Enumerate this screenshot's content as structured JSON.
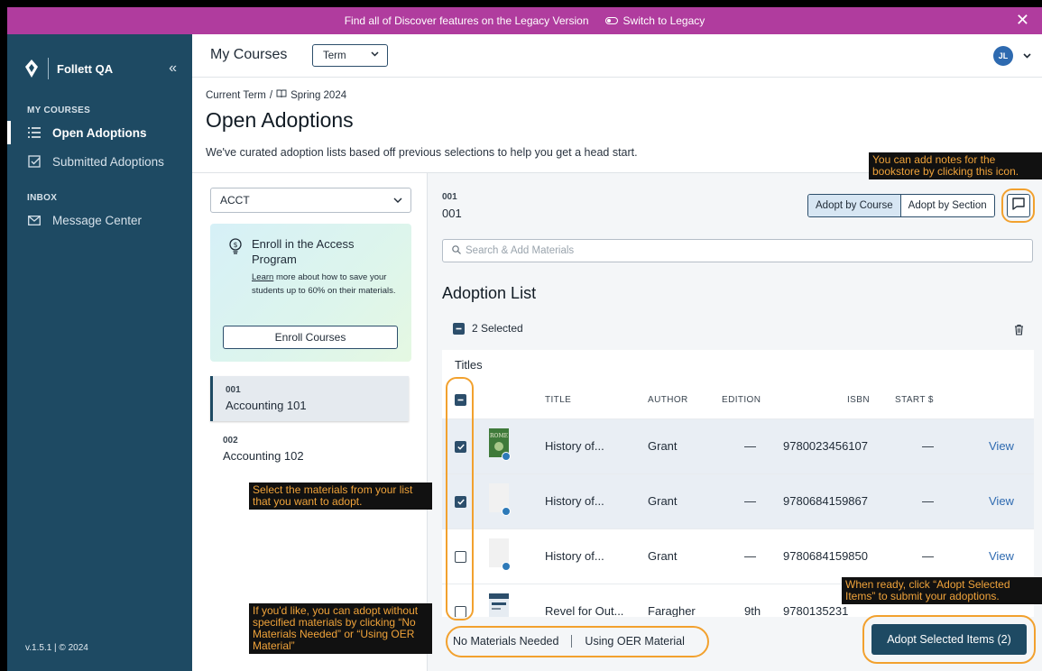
{
  "banner": {
    "text": "Find all of Discover features on the Legacy Version",
    "switch_label": "Switch to Legacy"
  },
  "sidebar": {
    "brand": "Follett QA",
    "section1": "MY COURSES",
    "items": [
      {
        "label": "Open Adoptions"
      },
      {
        "label": "Submitted Adoptions"
      }
    ],
    "section2": "INBOX",
    "inbox_item": "Message Center",
    "version": "v.1.5.1 | © 2024"
  },
  "header": {
    "title": "My Courses",
    "term_select": "Term",
    "avatar_initials": "JL"
  },
  "breadcrumb": {
    "current": "Current Term",
    "sep": "/",
    "term": "Spring 2024"
  },
  "page": {
    "title": "Open Adoptions",
    "subtitle": "We've curated adoption lists based off previous selections to help you get a head start."
  },
  "left": {
    "dept": "ACCT",
    "promo": {
      "title": "Enroll in the Access Program",
      "link": "Learn",
      "desc": " more about how to save your students up to 60% on their materials.",
      "button": "Enroll Courses"
    },
    "courses": [
      {
        "num": "001",
        "name": "Accounting 101"
      },
      {
        "num": "002",
        "name": "Accounting 102"
      }
    ]
  },
  "section": {
    "num": "001",
    "name": "001",
    "toggle": [
      "Adopt by Course",
      "Adopt by Section"
    ]
  },
  "search": {
    "placeholder": "Search & Add Materials"
  },
  "adoption": {
    "title": "Adoption List",
    "selected": "2 Selected",
    "titles_label": "Titles",
    "columns": [
      "TITLE",
      "AUTHOR",
      "EDITION",
      "ISBN",
      "START $"
    ],
    "rows": [
      {
        "title": "History of...",
        "author": "Grant",
        "edition": "—",
        "isbn": "9780023456107",
        "start": "—",
        "action": "View"
      },
      {
        "title": "History of...",
        "author": "Grant",
        "edition": "—",
        "isbn": "9780684159867",
        "start": "—",
        "action": "View"
      },
      {
        "title": "History of...",
        "author": "Grant",
        "edition": "—",
        "isbn": "9780684159850",
        "start": "—",
        "action": "View"
      },
      {
        "title": "Revel for Out...",
        "author": "Faragher",
        "edition": "9th",
        "isbn": "9780135231",
        "start": "",
        "action": ""
      }
    ]
  },
  "footer": {
    "no_materials": "No Materials Needed",
    "oer": "Using OER Material",
    "adopt_button": "Adopt Selected Items (2)"
  },
  "annotations": {
    "notes": "You can add notes for the bookstore by clicking this icon.",
    "select": "Select the materials from your list that you want to adopt.",
    "no_materials": "If you'd like, you can adopt without specified materials by clicking “No Materials Needed” or “Using OER Material”",
    "adopt": "When ready, click “Adopt Selected Items” to submit your adoptions."
  },
  "colors": {
    "banner": "#b03c9e",
    "sidebar": "#1e4a63",
    "highlight": "#f2a12e"
  }
}
